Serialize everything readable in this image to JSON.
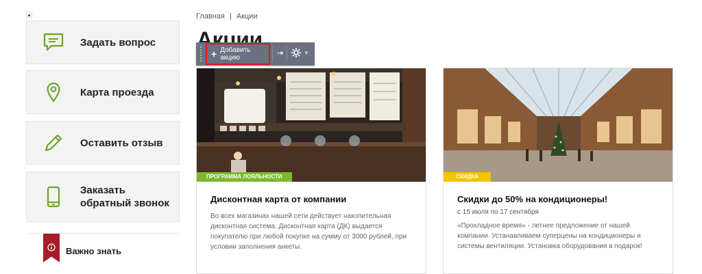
{
  "sidebar": {
    "items": [
      {
        "label": "Задать вопрос",
        "icon": "chat-icon"
      },
      {
        "label": "Карта проезда",
        "icon": "map-pin-icon"
      },
      {
        "label": "Оставить отзыв",
        "icon": "pencil-icon"
      },
      {
        "label": "Заказать обратный звонок",
        "icon": "phone-icon"
      }
    ],
    "important_label": "Важно знать",
    "important_icon": "info-icon"
  },
  "breadcrumb": [
    "Главная",
    "|",
    "Акции"
  ],
  "page": {
    "title": "Акции"
  },
  "toolbar": {
    "add_label": "Добавить акцию"
  },
  "promos": [
    {
      "tag": "ПРОГРАММА ЛОЯЛЬНОСТИ",
      "tag_color": "#7cb82f",
      "title": "Дисконтная карта от компании",
      "date": "",
      "description": "Во всех магазинах нашей сети действует накопительная дисконтная система. Дисконтная карта (ДК) выдается покупателю при любой покупке на сумму от 3000 рублей, при условии заполнения анкеты."
    },
    {
      "tag": "СКИДКА",
      "tag_color": "#f5c400",
      "title": "Скидки до 50% на кондиционеры!",
      "date": "с 15 июля по 17 сентября",
      "description": "«Прохладное время» - летнее предложение от нашей компании. Устанавливаем суперцены на кондиционеры и системы вентиляции. Установка оборудования в подарок!"
    }
  ],
  "colors": {
    "accent_green": "#6aa42b",
    "toolbar_bg": "#6c7181",
    "highlight_red": "#e0161b",
    "flag_red": "#a51c2a"
  }
}
